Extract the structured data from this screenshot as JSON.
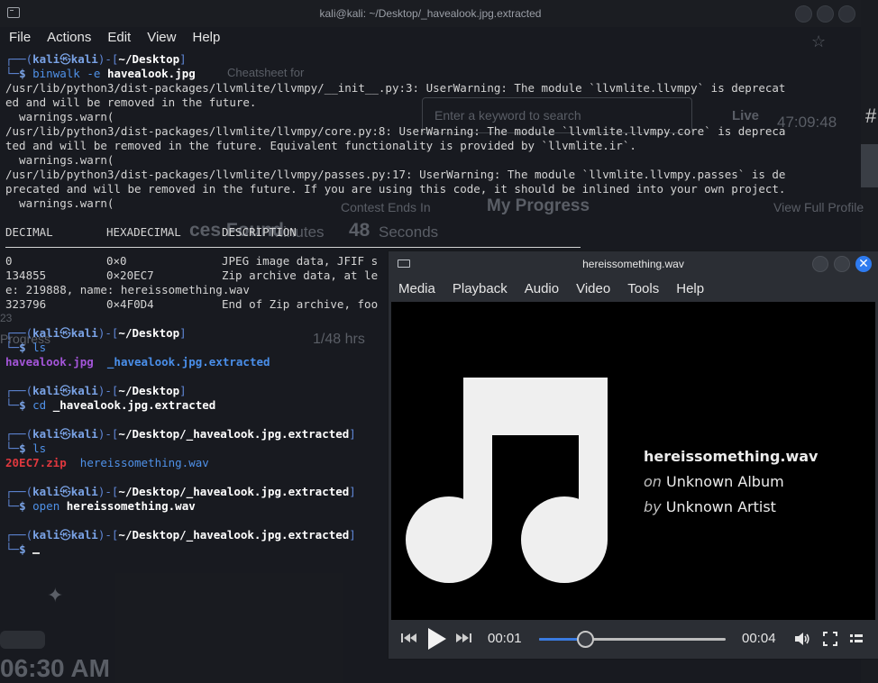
{
  "background": {
    "texts": [
      "Cheatsheet for",
      "Enter a keyword to search",
      "Live",
      "47:09:48",
      "Contest Ends In",
      "My Progress",
      "View Full Profile",
      "Minutes",
      "48",
      "Seconds",
      "23",
      "Progress",
      "1/48 hrs",
      "06:30 AM",
      "ces Found",
      "#"
    ]
  },
  "terminal": {
    "title": "kali@kali: ~/Desktop/_havealook.jpg.extracted",
    "menu": [
      "File",
      "Actions",
      "Edit",
      "View",
      "Help"
    ],
    "lines": {
      "p1_user": "kali",
      "p1_sym": "㉿",
      "p1_host": "kali",
      "p1_dir": "~/Desktop",
      "cmd1_name": "binwalk",
      "cmd1_flag": "-e",
      "cmd1_arg": "havealook.jpg",
      "w1a": "/usr/lib/python3/dist-packages/llvmlite/llvmpy/__init__.py:3: UserWarning: The module `llvmlite.llvmpy` is deprecat",
      "w1b": "ed and will be removed in the future.",
      "w1c": "  warnings.warn(",
      "w2a": "/usr/lib/python3/dist-packages/llvmlite/llvmpy/core.py:8: UserWarning: The module `llvmlite.llvmpy.core` is depreca",
      "w2b": "ted and will be removed in the future. Equivalent functionality is provided by `llvmlite.ir`.",
      "w2c": "  warnings.warn(",
      "w3a": "/usr/lib/python3/dist-packages/llvmlite/llvmpy/passes.py:17: UserWarning: The module `llvmlite.llvmpy.passes` is de",
      "w3b": "precated and will be removed in the future. If you are using this code, it should be inlined into your own project.",
      "w3c": "  warnings.warn(",
      "hdr_dec": "DECIMAL",
      "hdr_hex": "HEXADECIMAL",
      "hdr_desc": "DESCRIPTION",
      "r1_dec": "0",
      "r1_hex": "0×0",
      "r1_desc": "JPEG image data, JFIF s",
      "r2_dec": "134855",
      "r2_hex": "0×20EC7",
      "r2_desc": "Zip archive data, at le",
      "r2_cont": "e: 219888, name: hereissomething.wav",
      "r3_dec": "323796",
      "r3_hex": "0×4F0D4",
      "r3_desc": "End of Zip archive, foo",
      "cmd2": "ls",
      "ls1_a": "havealook.jpg",
      "ls1_b": "_havealook.jpg.extracted",
      "cmd3_name": "cd",
      "cmd3_arg": "_havealook.jpg.extracted",
      "p_dir2": "~/Desktop/_havealook.jpg.extracted",
      "cmd4": "ls",
      "ls2_a": "20EC7.zip",
      "ls2_b": "hereissomething.wav",
      "cmd5_name": "open",
      "cmd5_arg": "hereissomething.wav",
      "prompt_end": "$"
    }
  },
  "vlc": {
    "title": "hereissomething.wav",
    "menu": [
      "Media",
      "Playback",
      "Audio",
      "Video",
      "Tools",
      "Help"
    ],
    "track_title": "hereissomething.wav",
    "album_prefix": "on",
    "album": "Unknown Album",
    "artist_prefix": "by",
    "artist": "Unknown Artist",
    "elapsed": "00:01",
    "total": "00:04",
    "progress": 0.25,
    "close_glyph": "✕",
    "accent": "#3a7be0"
  }
}
